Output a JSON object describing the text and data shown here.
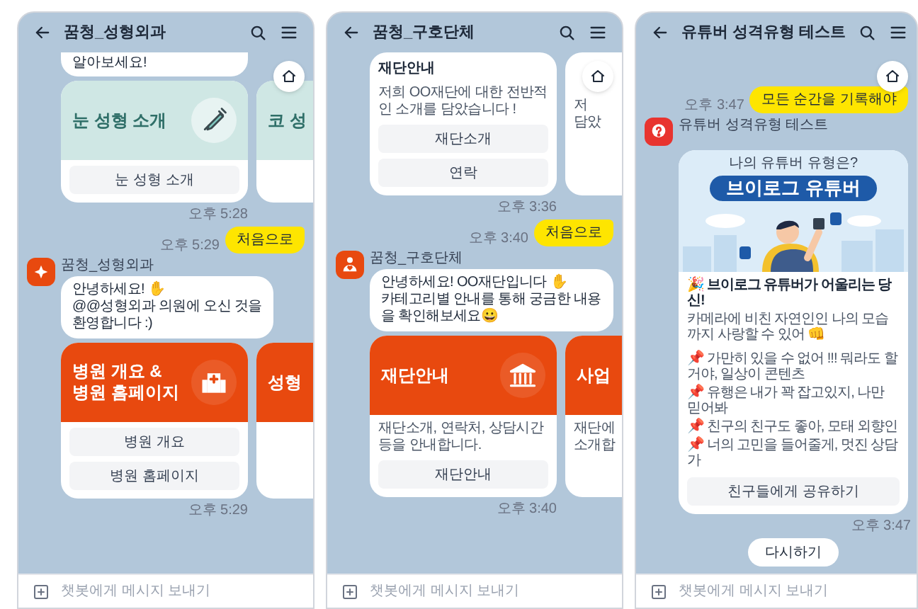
{
  "panels": [
    {
      "title": "꿈청_성형외과",
      "input_placeholder": "챗봇에게 메시지 보내기",
      "messages": [
        {
          "kind": "bubble_tail",
          "text": "알아보세요!"
        },
        {
          "kind": "carousel",
          "cards": [
            {
              "kind": "syringe",
              "title": "눈 성형 소개",
              "buttons": [
                "눈 성형 소개"
              ]
            },
            {
              "kind": "mint",
              "title": "코 성"
            }
          ]
        },
        {
          "kind": "time",
          "text": "오후 5:28"
        },
        {
          "kind": "sent",
          "text": "처음으로",
          "time": "오후 5:29"
        },
        {
          "kind": "bot",
          "name": "꿈청_성형외과",
          "text": "안녕하세요! ✋\n@@성형외과 의원에 오신 것을\n환영합니다 :)"
        },
        {
          "kind": "carousel",
          "cards": [
            {
              "kind": "hospital",
              "title": "병원 개요 &\n병원 홈페이지",
              "buttons": [
                "병원 개요",
                "병원 홈페이지"
              ]
            },
            {
              "kind": "orange",
              "title": "성형"
            }
          ]
        },
        {
          "kind": "time",
          "text": "오후 5:29"
        }
      ]
    },
    {
      "title": "꿈청_구호단체",
      "input_placeholder": "챗봇에게 메시지 보내기",
      "messages": [
        {
          "kind": "carousel",
          "cards": [
            {
              "kind": "plain",
              "title": "재단안내",
              "description": "저희 OO재단에 대한 전반적인 소개를 담았습니다 !",
              "buttons": [
                "재단소개",
                "연락"
              ]
            },
            {
              "kind": "plain",
              "description": "저\n담았"
            }
          ]
        },
        {
          "kind": "time",
          "text": "오후 3:36"
        },
        {
          "kind": "sent",
          "text": "처음으로",
          "time": "오후 3:40"
        },
        {
          "kind": "bot",
          "name": "꿈청_구호단체",
          "text": "안녕하세요! OO재단입니다 ✋\n카테고리별 안내를 통해 궁금한 내용을 확인해보세요😀"
        },
        {
          "kind": "carousel",
          "cards": [
            {
              "kind": "bank",
              "title": "재단안내",
              "description": "재단소개, 연락처, 상담시간 등을 안내합니다.",
              "buttons": [
                "재단안내"
              ]
            },
            {
              "kind": "orange",
              "title": "사업",
              "description": "재단에\n소개합"
            }
          ]
        },
        {
          "kind": "time",
          "text": "오후 3:40"
        }
      ]
    },
    {
      "title": "유튜버 성격유형 테스트",
      "input_placeholder": "챗봇에게 메시지 보내기",
      "messages": [
        {
          "kind": "sent",
          "text": "모든 순간을 기록해야",
          "time": "오후 3:47"
        },
        {
          "kind": "bot",
          "name": "유튜버 성격유형 테스트"
        },
        {
          "kind": "result",
          "question": "나의 유튜버 유형은?",
          "result": "브이로그 유튜버",
          "lines": [
            "🎉 브이로그 유튜버가 어울리는 당신!",
            "카메라에 비친 자연인인 나의 모습까지 사랑할 수 있어 👊",
            "📌 가만히 있을 수 없어 !!! 뭐라도 할거야, 일상이 콘텐츠",
            "📌 유행은 내가 꽉 잡고있지, 나만 믿어봐",
            "📌 친구의 친구도 좋아, 모태 외향인",
            "📌 너의 고민을 들어줄게, 멋진 상담가"
          ],
          "button": "친구들에게 공유하기",
          "time": "오후 3:47"
        },
        {
          "kind": "pill",
          "text": "다시하기"
        }
      ]
    }
  ]
}
